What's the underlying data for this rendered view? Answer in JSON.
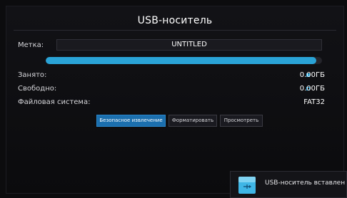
{
  "dialog": {
    "title": "USB-носитель"
  },
  "fields": {
    "label_caption": "Метка:",
    "label_value": "UNTITLED",
    "usage_fraction": 0.98,
    "used_caption": "Занято:",
    "used_value": "0.00ГБ",
    "free_caption": "Свободно:",
    "free_value": "0.00ГБ",
    "fs_caption": "Файловая система:",
    "fs_value": "FAT32"
  },
  "buttons": {
    "eject": "Безопасное извлечение",
    "format": "Форматировать",
    "view": "Просмотреть"
  },
  "toast": {
    "message": "USB-носитель вставлен"
  },
  "colors": {
    "accent": "#2aa3d6",
    "used_legend": "#2aa3d6",
    "free_legend": "#2aa3d6",
    "primary_button": "#1b6fae"
  },
  "icons": {
    "toast_icon": "usb-drive-icon"
  }
}
